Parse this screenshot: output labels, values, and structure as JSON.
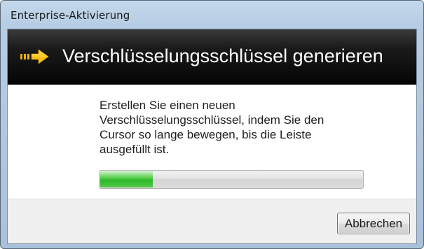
{
  "window": {
    "title": "Enterprise-Aktivierung"
  },
  "banner": {
    "icon": "arrow-right-icon",
    "title": "Verschlüsselungsschlüssel generieren",
    "accent_color": "#f5c018"
  },
  "main": {
    "instructions": "Erstellen Sie einen neuen Verschlüsselungsschlüssel, indem Sie den Cursor so lange bewegen, bis die Leiste ausgefüllt ist.",
    "progress_percent": 20,
    "progress_color": "#2db82a"
  },
  "footer": {
    "cancel_label": "Abbrechen"
  }
}
